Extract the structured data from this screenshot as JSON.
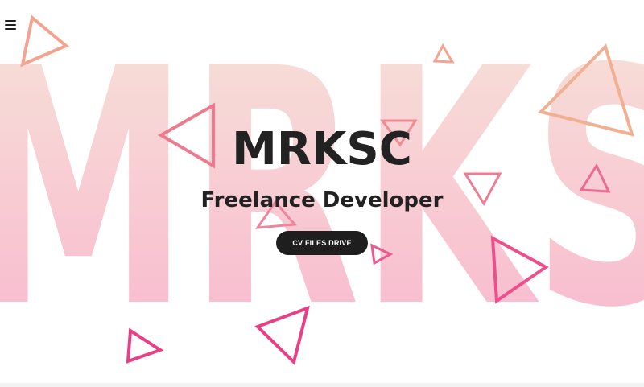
{
  "background_word": "MRKS",
  "brand": {
    "name": "MRKSC"
  },
  "hero": {
    "subtitle": "Freelance Developer"
  },
  "cta": {
    "label": "CV FILES DRIVE"
  },
  "nav": {
    "menu_icon": "hamburger-menu-icon"
  },
  "colors": {
    "gradient_top": "#f6d9cf",
    "gradient_bottom": "#f7aac6",
    "triangle_peach": "#f2a98a",
    "triangle_pink": "#ea3f86",
    "text": "#222222",
    "button": "#1e1e1e"
  }
}
